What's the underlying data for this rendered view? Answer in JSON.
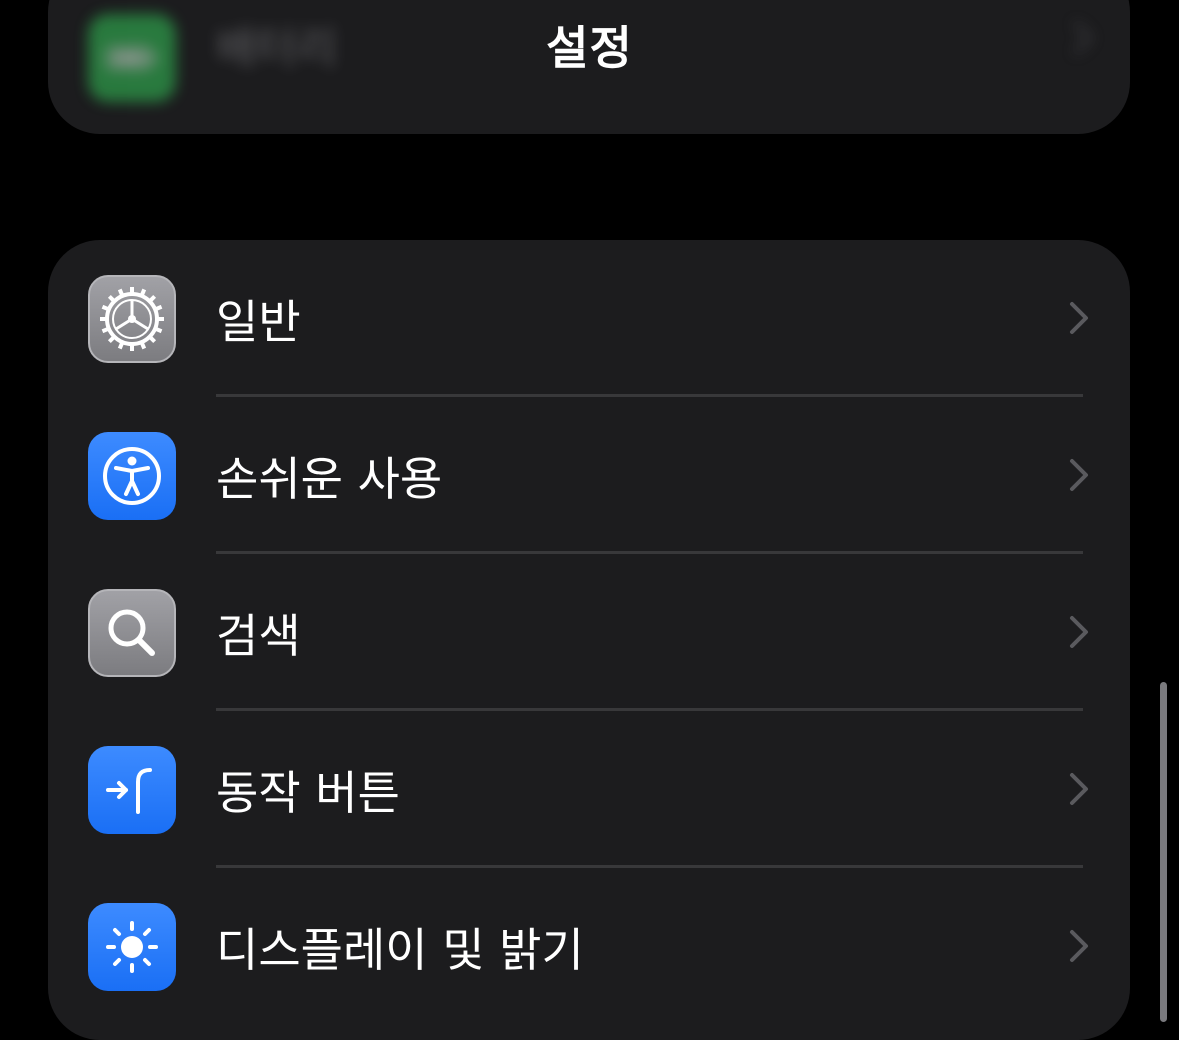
{
  "nav": {
    "title": "설정"
  },
  "top_group": {
    "item": {
      "label": "배터리",
      "icon": "battery-icon",
      "color": "#34c759"
    }
  },
  "settings": {
    "items": [
      {
        "label": "일반",
        "icon": "gear-icon",
        "color": "#8e8e93"
      },
      {
        "label": "손쉬운 사용",
        "icon": "accessibility-icon",
        "color": "#2f7df6"
      },
      {
        "label": "검색",
        "icon": "magnifier-icon",
        "color": "#8e8e93"
      },
      {
        "label": "동작 버튼",
        "icon": "action-button-icon",
        "color": "#2f7df6"
      },
      {
        "label": "디스플레이 및 밝기",
        "icon": "sun-icon",
        "color": "#2f7df6"
      }
    ]
  },
  "colors": {
    "background": "#000000",
    "group": "#1c1c1e",
    "separator": "#38383a",
    "chevron": "#5a5a5e"
  }
}
